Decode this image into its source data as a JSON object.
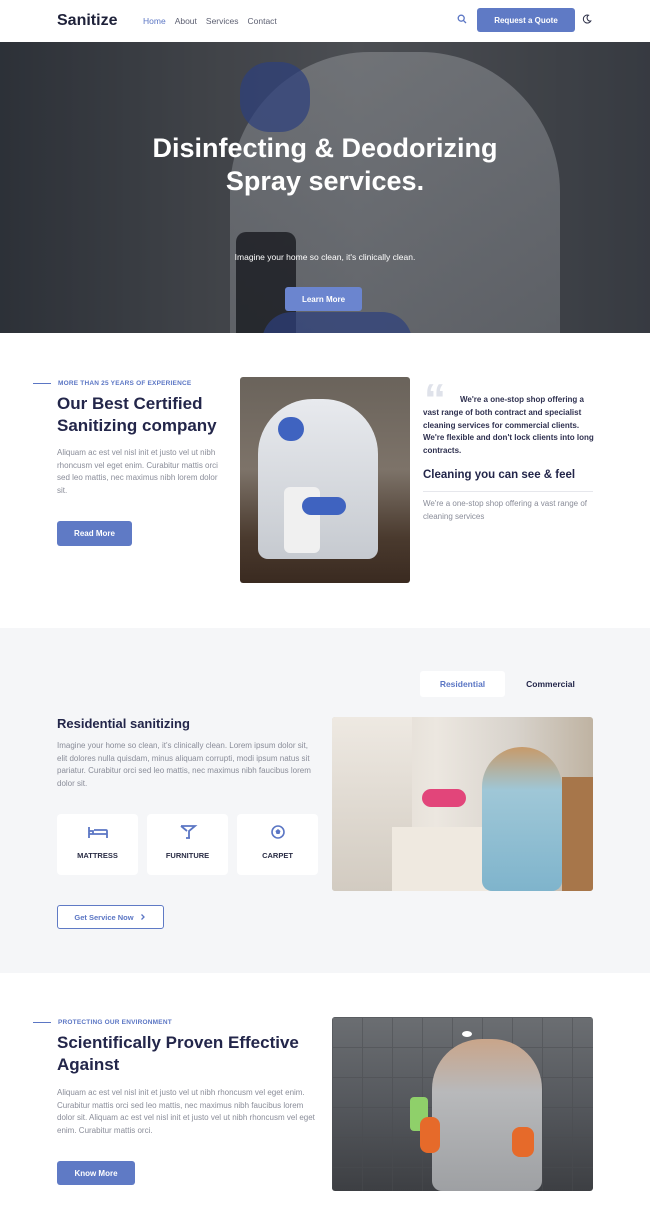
{
  "header": {
    "logo": "Sanitize",
    "nav": [
      "Home",
      "About",
      "Services",
      "Contact"
    ],
    "quote_button": "Request a Quote",
    "icons": [
      "search-icon",
      "moon-icon"
    ]
  },
  "hero": {
    "title_line1": "Disinfecting & Deodorizing",
    "title_line2": "Spray services.",
    "subtitle": "Imagine your home so clean, it's clinically clean.",
    "button": "Learn More",
    "slides": 4,
    "active_slide": 3
  },
  "about": {
    "eyebrow": "MORE THAN 25 YEARS OF EXPERIENCE",
    "title_line1": "Our Best Certified",
    "title_line2": "Sanitizing company",
    "text": "Aliquam ac est vel nisl init et justo vel ut nibh rhoncusm vel eget enim. Curabitur mattis orci sed leo mattis, nec maximus nibh lorem dolor sit.",
    "button": "Read More",
    "quote": "We're a one-stop shop offering a vast range of both contract and specialist cleaning services for commercial clients. We're flexible and don't lock clients into long contracts.",
    "subheading": "Cleaning you can see & feel",
    "subtext": "We're a one-stop shop offering a vast range of cleaning services"
  },
  "residential": {
    "tabs": [
      "Residential",
      "Commercial"
    ],
    "title": "Residential sanitizing",
    "text": "Imagine your home so clean, it's clinically clean. Lorem ipsum dolor sit, elit dolores nulla quisdam, minus aliquam corrupti, modi ipsum natus sit pariatur. Curabitur orci sed leo mattis, nec maximus nibh faucibus lorem dolor sit.",
    "cards": [
      {
        "label": "MATTRESS",
        "icon": "bed-icon"
      },
      {
        "label": "FURNITURE",
        "icon": "table-icon"
      },
      {
        "label": "CARPET",
        "icon": "ball-icon"
      }
    ],
    "button": "Get Service Now",
    "button_icon": "chevron-right-icon"
  },
  "protecting": {
    "eyebrow": "PROTECTING OUR ENVIRONMENT",
    "title_line1": "Scientifically Proven Effective",
    "title_line2": "Against",
    "text": "Aliquam ac est vel nisl init et justo vel ut nibh rhoncusm vel eget enim. Curabitur mattis orci sed leo mattis, nec maximus nibh faucibus lorem dolor sit. Aliquam ac est vel nisl init et justo vel ut nibh rhoncusm vel eget enim. Curabitur mattis orci.",
    "button": "Know More"
  },
  "colors": {
    "accent": "#5f7ac5",
    "heading": "#23264a",
    "muted": "#8a8d99",
    "section_bg": "#f5f6f8"
  }
}
